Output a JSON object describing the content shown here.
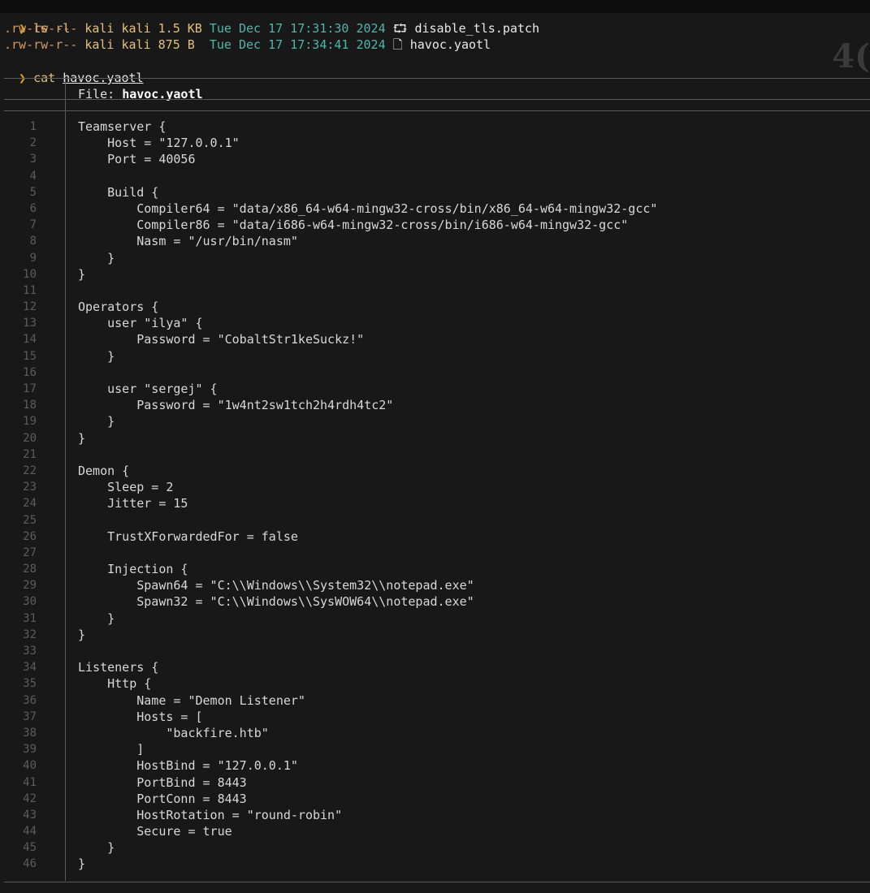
{
  "terminal": {
    "prompt_symbol": "❯",
    "commands": [
      {
        "text": "ls -l"
      },
      {
        "text": "cat",
        "arg": "havoc.yaotl"
      }
    ],
    "listing": [
      {
        "perms": ".rw-rw-r--",
        "user": "kali",
        "group": "kali",
        "size": "1.5 KB",
        "date": "Tue Dec 17 17:31:30 2024",
        "icon": "git-patch-icon",
        "icon_glyph": "⮔",
        "name": "disable_tls.patch"
      },
      {
        "perms": ".rw-rw-r--",
        "user": "kali",
        "group": "kali",
        "size": "875 B ",
        "date": "Tue Dec 17 17:34:41 2024",
        "icon": "file-icon",
        "icon_glyph": "🗋",
        "name": "havoc.yaotl"
      }
    ],
    "corner_text": "4("
  },
  "viewer": {
    "header_label": "File: ",
    "file_name": "havoc.yaotl",
    "lines": [
      "Teamserver {",
      "    Host = \"127.0.0.1\"",
      "    Port = 40056",
      "",
      "    Build {",
      "        Compiler64 = \"data/x86_64-w64-mingw32-cross/bin/x86_64-w64-mingw32-gcc\"",
      "        Compiler86 = \"data/i686-w64-mingw32-cross/bin/i686-w64-mingw32-gcc\"",
      "        Nasm = \"/usr/bin/nasm\"",
      "    }",
      "}",
      "",
      "Operators {",
      "    user \"ilya\" {",
      "        Password = \"CobaltStr1keSuckz!\"",
      "    }",
      "",
      "    user \"sergej\" {",
      "        Password = \"1w4nt2sw1tch2h4rdh4tc2\"",
      "    }",
      "}",
      "",
      "Demon {",
      "    Sleep = 2",
      "    Jitter = 15",
      "",
      "    TrustXForwardedFor = false",
      "",
      "    Injection {",
      "        Spawn64 = \"C:\\\\Windows\\\\System32\\\\notepad.exe\"",
      "        Spawn32 = \"C:\\\\Windows\\\\SysWOW64\\\\notepad.exe\"",
      "    }",
      "}",
      "",
      "Listeners {",
      "    Http {",
      "        Name = \"Demon Listener\"",
      "        Hosts = [",
      "            \"backfire.htb\"",
      "        ]",
      "        HostBind = \"127.0.0.1\"",
      "        PortBind = 8443",
      "        PortConn = 8443",
      "        HostRotation = \"round-robin\"",
      "        Secure = true",
      "    }",
      "}"
    ]
  }
}
